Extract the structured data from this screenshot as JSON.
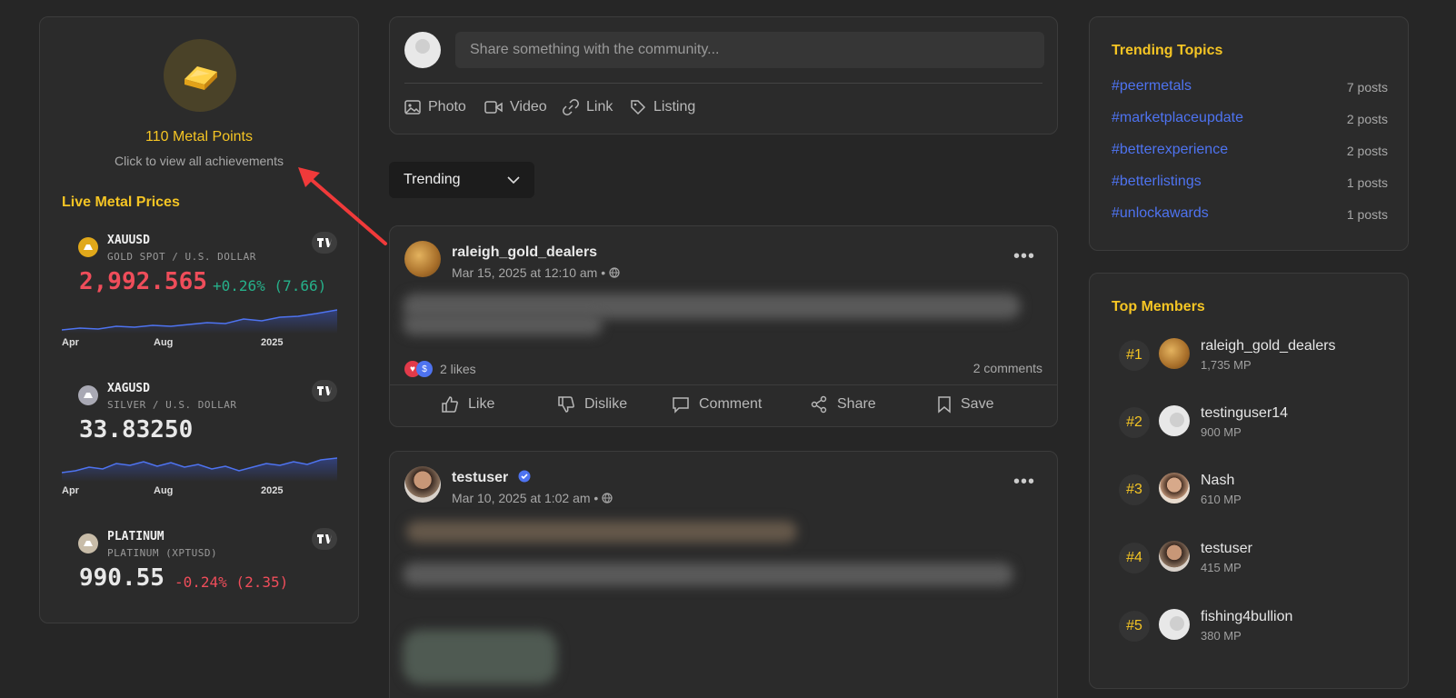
{
  "achievements": {
    "points": "110 Metal Points",
    "subtitle": "Click to view all achievements",
    "icon": "gold-bar-icon"
  },
  "live_prices": {
    "title": "Live Metal Prices",
    "metals": [
      {
        "symbol": "XAUUSD",
        "desc": "GOLD SPOT / U.S. DOLLAR",
        "price": "2,992.565",
        "change": "+0.26% (7.66)",
        "price_color": "#ef4d5a",
        "change_color": "#26b08a",
        "ticks": [
          "Apr",
          "Aug",
          "2025"
        ],
        "coin_color": "#e0a81a"
      },
      {
        "symbol": "XAGUSD",
        "desc": "SILVER / U.S. DOLLAR",
        "price": "33.83250",
        "change": "",
        "price_color": "#e8e8e8",
        "change_color": "#26b08a",
        "ticks": [
          "Apr",
          "Aug",
          "2025"
        ],
        "coin_color": "#a9a9b4"
      },
      {
        "symbol": "PLATINUM",
        "desc": "PLATINUM (XPTUSD)",
        "price": "990.55",
        "change": "-0.24% (2.35)",
        "price_color": "#e8e8e8",
        "change_color": "#ef4d5a",
        "ticks": [],
        "coin_color": "#c8bca8"
      }
    ],
    "tv_label": "TV"
  },
  "composer": {
    "placeholder": "Share something with the community...",
    "actions": [
      {
        "label": "Photo",
        "icon": "image-icon"
      },
      {
        "label": "Video",
        "icon": "video-icon"
      },
      {
        "label": "Link",
        "icon": "link-icon"
      },
      {
        "label": "Listing",
        "icon": "tag-icon"
      }
    ]
  },
  "feed_filter": {
    "selected": "Trending"
  },
  "posts": [
    {
      "user": "raleigh_gold_dealers",
      "date": "Mar 15, 2025 at 12:10 am •",
      "likes": "2 likes",
      "comments": "2 comments",
      "verified": false
    },
    {
      "user": "testuser",
      "date": "Mar 10, 2025 at 1:02 am •",
      "verified": true
    }
  ],
  "post_actions": [
    "Like",
    "Dislike",
    "Comment",
    "Share",
    "Save"
  ],
  "trending": {
    "title": "Trending Topics",
    "topics": [
      {
        "tag": "#peermetals",
        "count": "7 posts"
      },
      {
        "tag": "#marketplaceupdate",
        "count": "2 posts"
      },
      {
        "tag": "#betterexperience",
        "count": "2 posts"
      },
      {
        "tag": "#betterlistings",
        "count": "1 posts"
      },
      {
        "tag": "#unlockawards",
        "count": "1 posts"
      }
    ]
  },
  "top_members": {
    "title": "Top Members",
    "members": [
      {
        "rank": "#1",
        "name": "raleigh_gold_dealers",
        "mp": "1,735 MP",
        "avatar": "coin"
      },
      {
        "rank": "#2",
        "name": "testinguser14",
        "mp": "900 MP",
        "avatar": "blank"
      },
      {
        "rank": "#3",
        "name": "Nash",
        "mp": "610 MP",
        "avatar": "face"
      },
      {
        "rank": "#4",
        "name": "testuser",
        "mp": "415 MP",
        "avatar": "face"
      },
      {
        "rank": "#5",
        "name": "fishing4bullion",
        "mp": "380 MP",
        "avatar": "blank"
      }
    ]
  }
}
